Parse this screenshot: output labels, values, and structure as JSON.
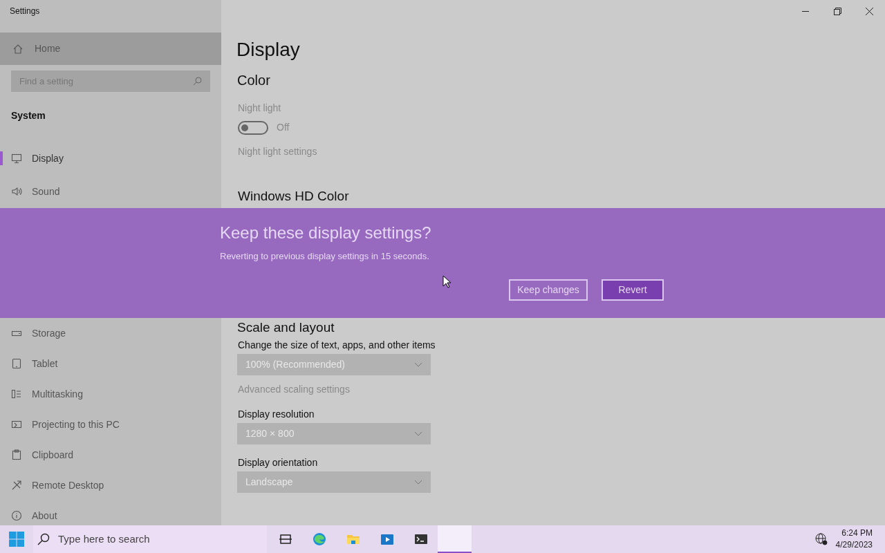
{
  "window": {
    "title": "Settings"
  },
  "sidebar": {
    "home": {
      "label": "Home"
    },
    "search": {
      "placeholder": "Find a setting"
    },
    "section": "System",
    "items_above": [
      {
        "label": "Display",
        "kind": "monitor",
        "selected": true
      },
      {
        "label": "Sound",
        "kind": "speaker",
        "selected": false
      }
    ],
    "items_below": [
      {
        "label": "Storage",
        "kind": "drive",
        "selected": false
      },
      {
        "label": "Tablet",
        "kind": "tablet",
        "selected": false
      },
      {
        "label": "Multitasking",
        "kind": "multitask",
        "selected": false
      },
      {
        "label": "Projecting to this PC",
        "kind": "project",
        "selected": false
      },
      {
        "label": "Clipboard",
        "kind": "clipboard",
        "selected": false
      },
      {
        "label": "Remote Desktop",
        "kind": "remote",
        "selected": false
      },
      {
        "label": "About",
        "kind": "info",
        "selected": false
      }
    ]
  },
  "page": {
    "title": "Display",
    "color_heading": "Color",
    "night_light": {
      "label": "Night light",
      "on": false,
      "state_label": "Off",
      "link": "Night light settings"
    },
    "hd_color_heading": "Windows HD Color",
    "scale_heading": "Scale and layout",
    "settings": [
      {
        "kind": "dropdown",
        "label": "Change the size of text, apps, and other items",
        "value": "100% (Recommended)"
      },
      {
        "kind": "link",
        "label": "Advanced scaling settings"
      },
      {
        "kind": "dropdown",
        "label": "Display resolution",
        "value": "1280 × 800"
      },
      {
        "kind": "dropdown",
        "label": "Display orientation",
        "value": "Landscape"
      }
    ]
  },
  "dialog": {
    "title": "Keep these display settings?",
    "message": "Reverting to previous display settings in 15 seconds.",
    "buttons": [
      {
        "label": "Keep changes",
        "primary": false
      },
      {
        "label": "Revert",
        "primary": true
      }
    ]
  },
  "taskbar": {
    "search_placeholder": "Type here to search",
    "apps": [
      {
        "kind": "taskview",
        "active": false
      },
      {
        "kind": "browser",
        "active": false
      },
      {
        "kind": "folder",
        "active": false
      },
      {
        "kind": "media",
        "active": false
      },
      {
        "kind": "terminal",
        "active": false
      },
      {
        "kind": "blank",
        "active": true
      }
    ],
    "time": "6:24 PM",
    "date": "4/29/2023"
  }
}
